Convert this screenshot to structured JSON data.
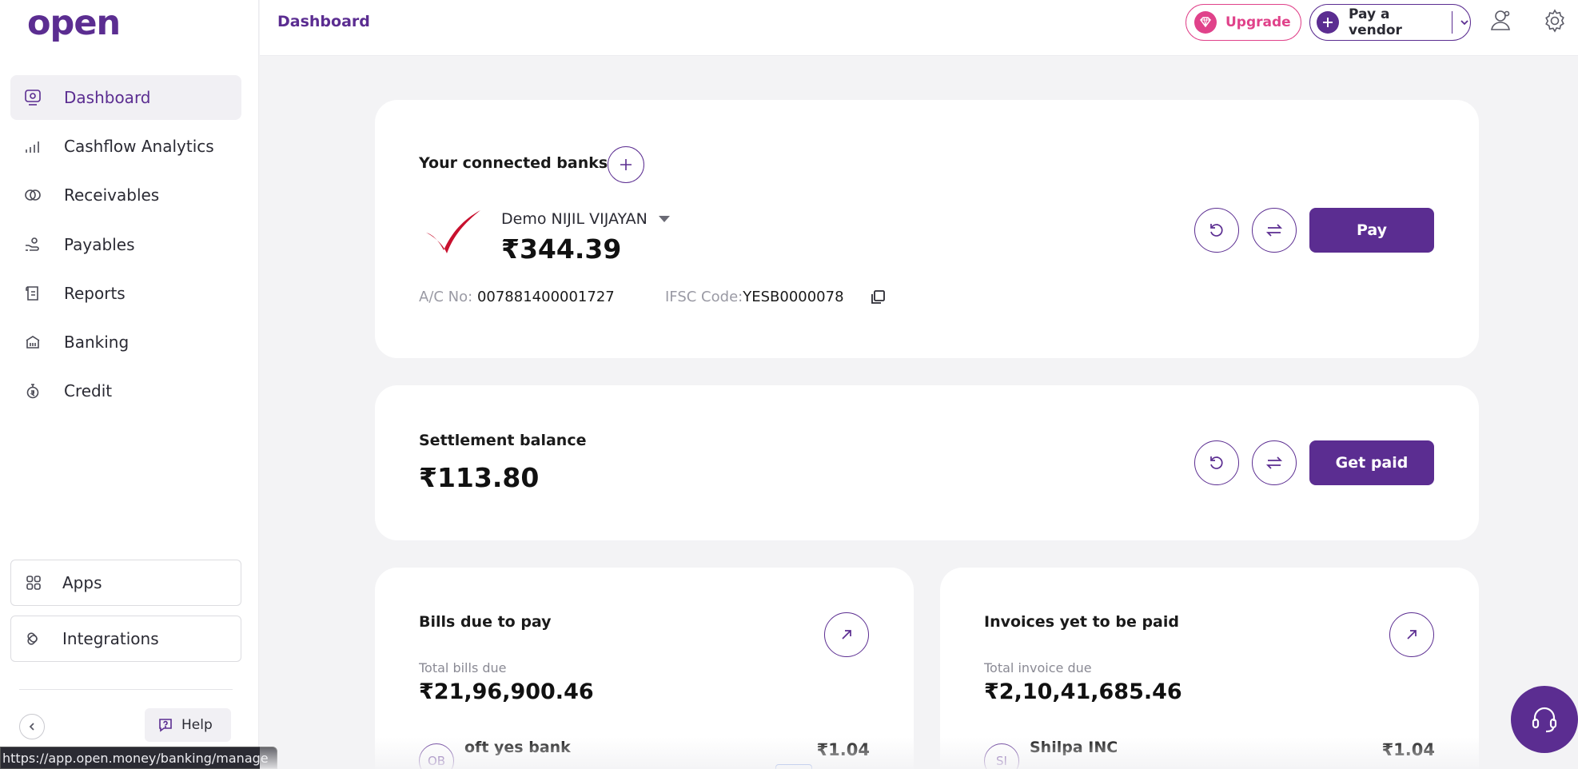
{
  "brand": {
    "logo_text": "open",
    "accent": "#5b2d91",
    "pink": "#e0428a"
  },
  "header": {
    "title": "Dashboard",
    "upgrade_label": "Upgrade",
    "pay_vendor_label": "Pay a vendor"
  },
  "sidebar": {
    "items": [
      {
        "label": "Dashboard",
        "icon": "dashboard-icon",
        "active": true
      },
      {
        "label": "Cashflow Analytics",
        "icon": "bar-chart-icon"
      },
      {
        "label": "Receivables",
        "icon": "receivables-icon"
      },
      {
        "label": "Payables",
        "icon": "payables-icon"
      },
      {
        "label": "Reports",
        "icon": "reports-icon"
      },
      {
        "label": "Banking",
        "icon": "bank-icon"
      },
      {
        "label": "Credit",
        "icon": "credit-icon"
      }
    ],
    "apps_label": "Apps",
    "integrations_label": "Integrations",
    "help_label": "Help"
  },
  "status_bar": {
    "url": "https://app.open.money/banking/manage"
  },
  "banks": {
    "title": "Your connected banks",
    "bank_name": "Demo NIJIL VIJAYAN",
    "balance": "₹344.39",
    "acc_label": "A/C No:",
    "acc_number": "007881400001727",
    "ifsc_label": "IFSC Code:",
    "ifsc_code": "YESB0000078",
    "pay_label": "Pay"
  },
  "settlement": {
    "title": "Settlement balance",
    "balance": "₹113.80",
    "get_paid_label": "Get paid"
  },
  "bills": {
    "title": "Bills due to pay",
    "sub_label": "Total bills due",
    "total": "₹21,96,900.46",
    "row_initials": "OB",
    "row_name": "oft yes bank",
    "row_amount": "₹1.04"
  },
  "invoices": {
    "title": "Invoices yet to be paid",
    "sub_label": "Total invoice due",
    "total": "₹2,10,41,685.46",
    "row_initials": "SI",
    "row_name": "Shilpa INC",
    "row_amount": "₹1.04"
  }
}
